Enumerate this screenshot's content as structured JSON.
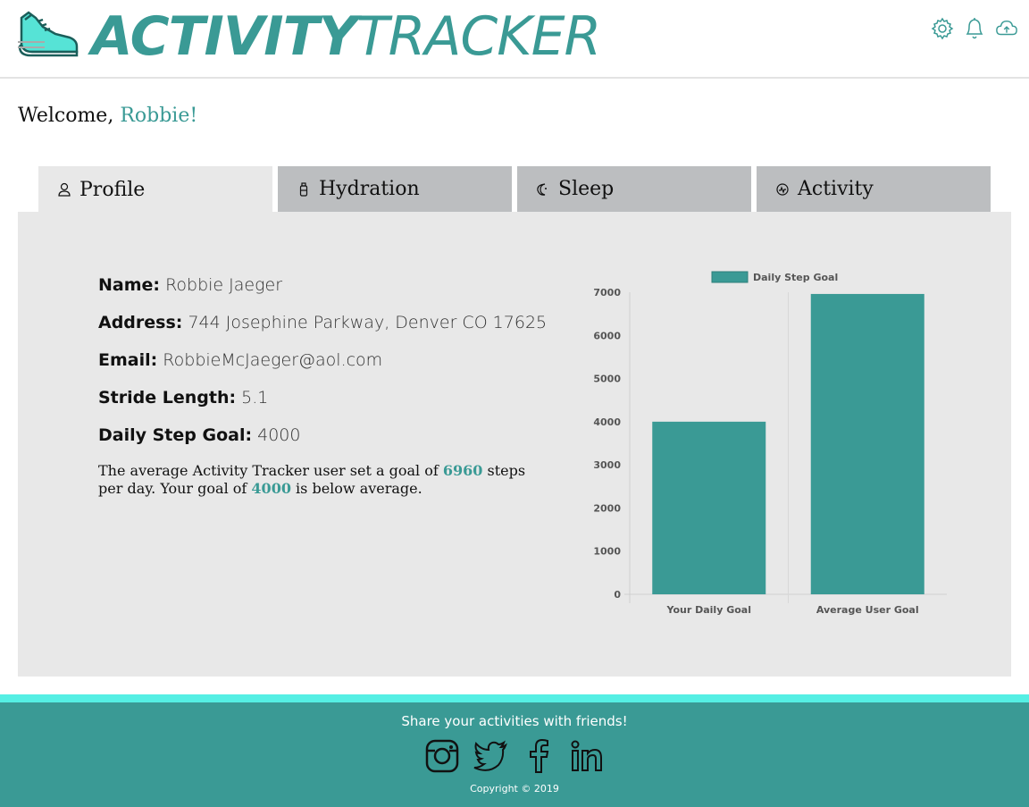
{
  "header": {
    "brand_bold": "ACTIVITY",
    "brand_light": "TRACKER",
    "icons": [
      "shoe-logo-icon",
      "menu-icon",
      "gear-icon",
      "bell-icon",
      "cloud-upload-icon"
    ]
  },
  "welcome": {
    "prefix": "Welcome, ",
    "name": "Robbie!"
  },
  "tabs": [
    {
      "label": "Profile",
      "icon": "user-icon",
      "active": true
    },
    {
      "label": "Hydration",
      "icon": "bottle-icon",
      "active": false
    },
    {
      "label": "Sleep",
      "icon": "moon-icon",
      "active": false
    },
    {
      "label": "Activity",
      "icon": "activity-icon",
      "active": false
    }
  ],
  "profile": {
    "name_label": "Name:",
    "name": "Robbie Jaeger",
    "address_label": "Address:",
    "address": "744 Josephine Parkway, Denver CO 17625",
    "email_label": "Email:",
    "email": "RobbieMcJaeger@aol.com",
    "stride_label": "Stride Length:",
    "stride": "5.1",
    "goal_label": "Daily Step Goal:",
    "goal": "4000",
    "note_a": "The average Activity Tracker user set a goal of ",
    "avg_goal": "6960",
    "note_b": " steps per day. Your goal of ",
    "user_goal": "4000",
    "note_c": " is below average."
  },
  "chart_data": {
    "type": "bar",
    "categories": [
      "Your Daily Goal",
      "Average User Goal"
    ],
    "series": [
      {
        "name": "Daily Step Goal",
        "values": [
          4000,
          6960
        ]
      }
    ],
    "ylim": [
      0,
      7000
    ],
    "yticks": [
      0,
      1000,
      2000,
      3000,
      4000,
      5000,
      6000,
      7000
    ],
    "legend": "top",
    "color": "#3a9a95",
    "grid": false
  },
  "footer": {
    "share": "Share your activities with friends!",
    "copyright": "Copyright © 2019",
    "socials": [
      "instagram-icon",
      "twitter-icon",
      "facebook-icon",
      "linkedin-icon"
    ]
  },
  "colors": {
    "accent": "#3a9a95",
    "strip": "#55efe4",
    "tab": "#bcbec0",
    "panel": "#e8e8e8"
  }
}
